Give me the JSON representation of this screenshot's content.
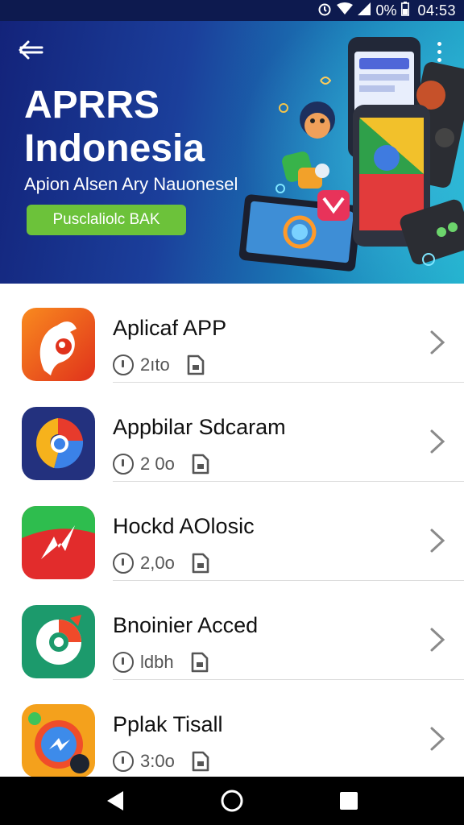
{
  "status_bar": {
    "time": "04:53",
    "battery_text": "0%",
    "icons": [
      "alarm-icon",
      "wifi-icon",
      "signal-icon",
      "battery-icon"
    ]
  },
  "header": {
    "title": "APRRS Indonesia",
    "subtitle": "Apion Alsen Ary Nauonesel",
    "cta_label": "Pusclaliolc BAK",
    "colors": {
      "gradient_start": "#13237a",
      "gradient_end": "#24b3cf",
      "cta": "#6cc23a"
    }
  },
  "apps": [
    {
      "name": "Aplicaf APP",
      "meta": "2ıto",
      "icon": "orange-fox-app-icon",
      "color": "#f25a1a"
    },
    {
      "name": "Appbilar Sdcaram",
      "meta": "2 0o",
      "icon": "chrome-swirl-app-icon",
      "color": "#2a3a8f"
    },
    {
      "name": "Hockd AOlosic",
      "meta": "2,0o",
      "icon": "lightning-app-icon",
      "color": "#e02a2a"
    },
    {
      "name": "Bnoinier Acced",
      "meta": "ldbh",
      "icon": "green-swirl-app-icon",
      "color": "#1e9e6e"
    },
    {
      "name": "Pplak Tisall",
      "meta": "3:0o",
      "icon": "messenger-app-icon",
      "color": "#f3a21c"
    }
  ],
  "nav": {
    "icons": [
      "back-triangle-icon",
      "home-circle-icon",
      "recents-square-icon"
    ]
  }
}
